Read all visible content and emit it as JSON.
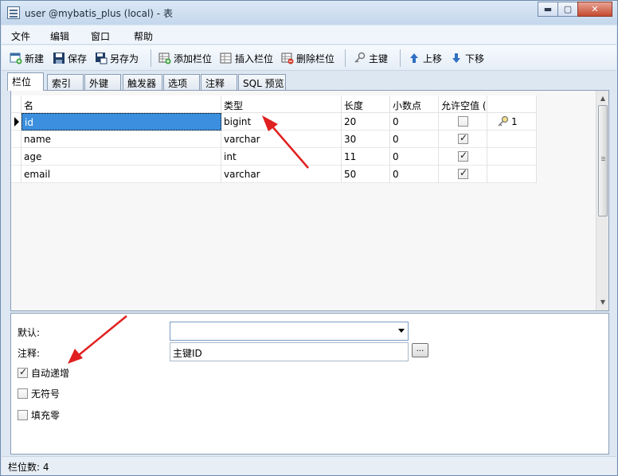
{
  "window": {
    "title": "user @mybatis_plus (local) - 表",
    "controls": {
      "minimize": "▬",
      "maximize": "▢",
      "close": "✕"
    }
  },
  "menu": [
    "文件",
    "编辑",
    "窗口",
    "帮助"
  ],
  "toolbar": {
    "new": "新建",
    "save": "保存",
    "save_as": "另存为",
    "add_column": "添加栏位",
    "insert_column": "插入栏位",
    "delete_column": "删除栏位",
    "primary_key": "主键",
    "move_up": "上移",
    "move_down": "下移"
  },
  "tabs": [
    "栏位",
    "索引",
    "外键",
    "触发器",
    "选项",
    "注释",
    "SQL 预览"
  ],
  "grid": {
    "headers": [
      "名",
      "类型",
      "长度",
      "小数点",
      "允许空值 (",
      ""
    ],
    "rows": [
      {
        "name": "id",
        "type": "bigint",
        "length": "20",
        "decimals": "0",
        "allow_null": false,
        "key": "1",
        "selected": true
      },
      {
        "name": "name",
        "type": "varchar",
        "length": "30",
        "decimals": "0",
        "allow_null": true,
        "key": ""
      },
      {
        "name": "age",
        "type": "int",
        "length": "11",
        "decimals": "0",
        "allow_null": true,
        "key": ""
      },
      {
        "name": "email",
        "type": "varchar",
        "length": "50",
        "decimals": "0",
        "allow_null": true,
        "key": ""
      }
    ]
  },
  "props": {
    "default_label": "默认:",
    "default_value": "",
    "comment_label": "注释:",
    "comment_value": "主键ID",
    "ellipsis": "...",
    "auto_increment_label": "自动递增",
    "auto_increment": true,
    "unsigned_label": "无符号",
    "unsigned": false,
    "zerofill_label": "填充零",
    "zerofill": false
  },
  "status": {
    "text": "栏位数: 4"
  },
  "colors": {
    "selection": "#3c8fde",
    "annotation_arrow": "#e02020"
  }
}
